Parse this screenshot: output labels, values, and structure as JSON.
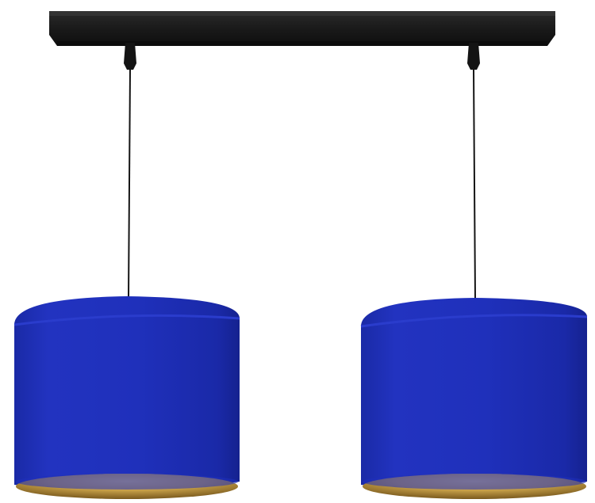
{
  "image": {
    "subject": "pendant-lamp",
    "colors": {
      "background": "#ffffff",
      "canopy": "#1a1a1a",
      "cord": "#151515",
      "shade_outer": "#1f2fb8",
      "shade_highlight": "#2a3ccc",
      "shade_shadow": "#15228f",
      "shade_inner_gold": "#c9a24a",
      "shade_inner_gold_dark": "#7a5a1e"
    }
  }
}
